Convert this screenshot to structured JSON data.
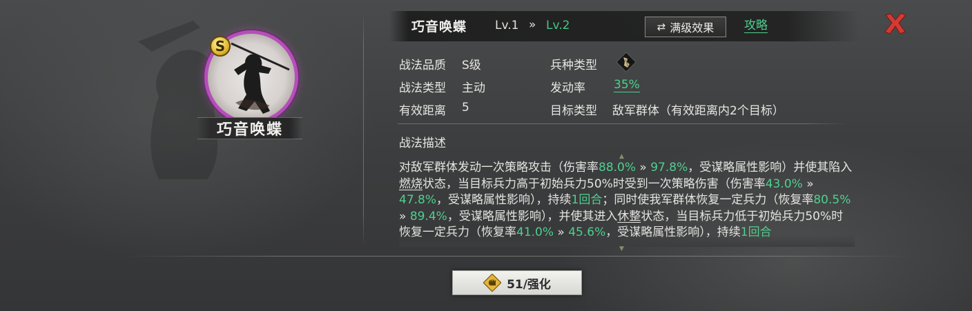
{
  "portrait": {
    "grade_badge": "S",
    "name": "巧音唤蝶"
  },
  "header": {
    "title": "巧音唤蝶",
    "level_current": "Lv.1",
    "level_arrow": "»",
    "level_next": "Lv.2",
    "max_effect_label": "满级效果",
    "guide_label": "攻略"
  },
  "attributes": {
    "quality_label": "战法品质",
    "quality_value": "S级",
    "type_label": "战法类型",
    "type_value": "主动",
    "range_label": "有效距离",
    "range_value": "5",
    "troop_label": "兵种类型",
    "rate_label": "发动率",
    "rate_value": "35%",
    "target_label": "目标类型",
    "target_value": "敌军群体（有效距离内2个目标）"
  },
  "description": {
    "title": "战法描述",
    "seg": {
      "s1": "对敌军群体发动一次策略攻击（伤害率",
      "s2": "88.0%",
      "s3": " » ",
      "s4": "97.8%",
      "s5": "，受谋略属性影响）并使其陷入",
      "s6": "燃烧",
      "s7": "状态，当目标兵力高于初始兵力50%时受到一次策略伤害（伤害率",
      "s8": "43.0%",
      "s9": " » ",
      "s10": "47.8%",
      "s11": "，受谋略属性影响），持续",
      "s12": "1回合",
      "s13": "；同时使我军群体恢复一定兵力（恢复率",
      "s14": "80.5%",
      "s15": " » ",
      "s16": "89.4%",
      "s17": "，受谋略属性影响），并使其进入",
      "s18": "休整",
      "s19": "状态，当目标兵力低于初始兵力50%时恢复一定兵力（恢复率",
      "s20": "41.0%",
      "s21": " » ",
      "s22": "45.6%",
      "s23": "，受谋略属性影响），持续",
      "s24": "1回合"
    }
  },
  "bottom": {
    "enhance_label": "51/强化"
  },
  "icons": {
    "close": "close-icon",
    "swap": "swap-icon",
    "troop": "troop-type-icon",
    "enhance": "fist-icon"
  },
  "colors": {
    "accent_green": "#4fd08f",
    "close_red": "#d23a34",
    "portrait_ring": "#b54fb8",
    "badge_gold": "#e2b730"
  }
}
